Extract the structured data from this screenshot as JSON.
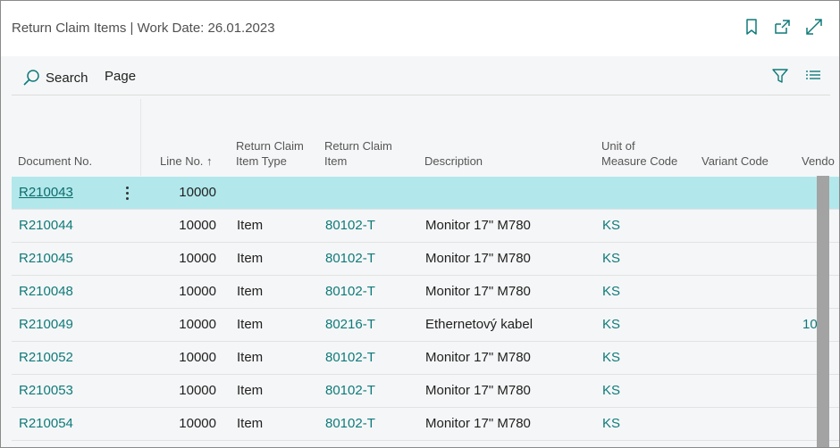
{
  "title": "Return Claim Items | Work Date: 26.01.2023",
  "titlebar_icons": [
    "bookmark-icon",
    "open-in-new-window-icon",
    "expand-icon"
  ],
  "actions": {
    "search_label": "Search",
    "page_label": "Page"
  },
  "headers": {
    "document_no": "Document No.",
    "line_no": "Line No.",
    "line_no_sort": "↑",
    "item_type_1": "Return Claim",
    "item_type_2": "Item Type",
    "item_1": "Return Claim",
    "item_2": "Item",
    "description": "Description",
    "uom_1": "Unit of",
    "uom_2": "Measure Code",
    "variant_code": "Variant Code",
    "vendor": "Vendo"
  },
  "rows": [
    {
      "doc": "R210043",
      "line": "10000",
      "type": "",
      "item": "",
      "desc": "",
      "uom": "",
      "vendor": ""
    },
    {
      "doc": "R210044",
      "line": "10000",
      "type": "Item",
      "item": "80102-T",
      "desc": "Monitor 17\" M780",
      "uom": "KS",
      "vendor": ""
    },
    {
      "doc": "R210045",
      "line": "10000",
      "type": "Item",
      "item": "80102-T",
      "desc": "Monitor 17\" M780",
      "uom": "KS",
      "vendor": ""
    },
    {
      "doc": "R210048",
      "line": "10000",
      "type": "Item",
      "item": "80102-T",
      "desc": "Monitor 17\" M780",
      "uom": "KS",
      "vendor": ""
    },
    {
      "doc": "R210049",
      "line": "10000",
      "type": "Item",
      "item": "80216-T",
      "desc": "Ethernetový kabel",
      "uom": "KS",
      "vendor": "10"
    },
    {
      "doc": "R210052",
      "line": "10000",
      "type": "Item",
      "item": "80102-T",
      "desc": "Monitor 17\" M780",
      "uom": "KS",
      "vendor": ""
    },
    {
      "doc": "R210053",
      "line": "10000",
      "type": "Item",
      "item": "80102-T",
      "desc": "Monitor 17\" M780",
      "uom": "KS",
      "vendor": ""
    },
    {
      "doc": "R210054",
      "line": "10000",
      "type": "Item",
      "item": "80102-T",
      "desc": "Monitor 17\" M780",
      "uom": "KS",
      "vendor": ""
    }
  ],
  "colors": {
    "accent": "#0f7a7a",
    "selected_row": "#b2e8ec",
    "background": "#f5f6f7"
  }
}
